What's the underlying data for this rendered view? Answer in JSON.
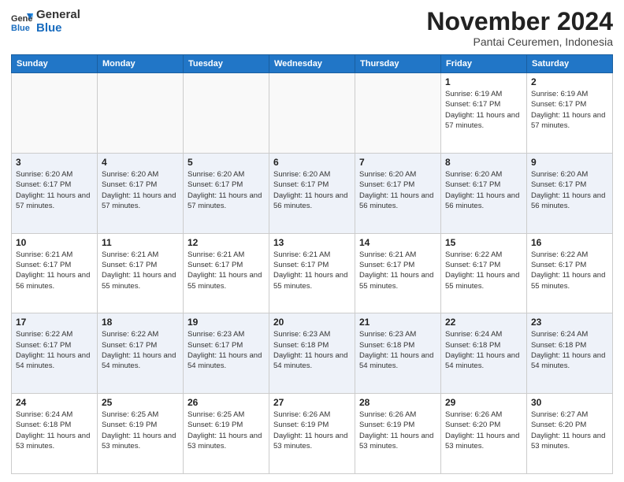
{
  "logo": {
    "general": "General",
    "blue": "Blue"
  },
  "title": "November 2024",
  "location": "Pantai Ceuremen, Indonesia",
  "days_header": [
    "Sunday",
    "Monday",
    "Tuesday",
    "Wednesday",
    "Thursday",
    "Friday",
    "Saturday"
  ],
  "weeks": [
    [
      {
        "day": "",
        "sunrise": "",
        "sunset": "",
        "daylight": ""
      },
      {
        "day": "",
        "sunrise": "",
        "sunset": "",
        "daylight": ""
      },
      {
        "day": "",
        "sunrise": "",
        "sunset": "",
        "daylight": ""
      },
      {
        "day": "",
        "sunrise": "",
        "sunset": "",
        "daylight": ""
      },
      {
        "day": "",
        "sunrise": "",
        "sunset": "",
        "daylight": ""
      },
      {
        "day": "1",
        "sunrise": "Sunrise: 6:19 AM",
        "sunset": "Sunset: 6:17 PM",
        "daylight": "Daylight: 11 hours and 57 minutes."
      },
      {
        "day": "2",
        "sunrise": "Sunrise: 6:19 AM",
        "sunset": "Sunset: 6:17 PM",
        "daylight": "Daylight: 11 hours and 57 minutes."
      }
    ],
    [
      {
        "day": "3",
        "sunrise": "Sunrise: 6:20 AM",
        "sunset": "Sunset: 6:17 PM",
        "daylight": "Daylight: 11 hours and 57 minutes."
      },
      {
        "day": "4",
        "sunrise": "Sunrise: 6:20 AM",
        "sunset": "Sunset: 6:17 PM",
        "daylight": "Daylight: 11 hours and 57 minutes."
      },
      {
        "day": "5",
        "sunrise": "Sunrise: 6:20 AM",
        "sunset": "Sunset: 6:17 PM",
        "daylight": "Daylight: 11 hours and 57 minutes."
      },
      {
        "day": "6",
        "sunrise": "Sunrise: 6:20 AM",
        "sunset": "Sunset: 6:17 PM",
        "daylight": "Daylight: 11 hours and 56 minutes."
      },
      {
        "day": "7",
        "sunrise": "Sunrise: 6:20 AM",
        "sunset": "Sunset: 6:17 PM",
        "daylight": "Daylight: 11 hours and 56 minutes."
      },
      {
        "day": "8",
        "sunrise": "Sunrise: 6:20 AM",
        "sunset": "Sunset: 6:17 PM",
        "daylight": "Daylight: 11 hours and 56 minutes."
      },
      {
        "day": "9",
        "sunrise": "Sunrise: 6:20 AM",
        "sunset": "Sunset: 6:17 PM",
        "daylight": "Daylight: 11 hours and 56 minutes."
      }
    ],
    [
      {
        "day": "10",
        "sunrise": "Sunrise: 6:21 AM",
        "sunset": "Sunset: 6:17 PM",
        "daylight": "Daylight: 11 hours and 56 minutes."
      },
      {
        "day": "11",
        "sunrise": "Sunrise: 6:21 AM",
        "sunset": "Sunset: 6:17 PM",
        "daylight": "Daylight: 11 hours and 55 minutes."
      },
      {
        "day": "12",
        "sunrise": "Sunrise: 6:21 AM",
        "sunset": "Sunset: 6:17 PM",
        "daylight": "Daylight: 11 hours and 55 minutes."
      },
      {
        "day": "13",
        "sunrise": "Sunrise: 6:21 AM",
        "sunset": "Sunset: 6:17 PM",
        "daylight": "Daylight: 11 hours and 55 minutes."
      },
      {
        "day": "14",
        "sunrise": "Sunrise: 6:21 AM",
        "sunset": "Sunset: 6:17 PM",
        "daylight": "Daylight: 11 hours and 55 minutes."
      },
      {
        "day": "15",
        "sunrise": "Sunrise: 6:22 AM",
        "sunset": "Sunset: 6:17 PM",
        "daylight": "Daylight: 11 hours and 55 minutes."
      },
      {
        "day": "16",
        "sunrise": "Sunrise: 6:22 AM",
        "sunset": "Sunset: 6:17 PM",
        "daylight": "Daylight: 11 hours and 55 minutes."
      }
    ],
    [
      {
        "day": "17",
        "sunrise": "Sunrise: 6:22 AM",
        "sunset": "Sunset: 6:17 PM",
        "daylight": "Daylight: 11 hours and 54 minutes."
      },
      {
        "day": "18",
        "sunrise": "Sunrise: 6:22 AM",
        "sunset": "Sunset: 6:17 PM",
        "daylight": "Daylight: 11 hours and 54 minutes."
      },
      {
        "day": "19",
        "sunrise": "Sunrise: 6:23 AM",
        "sunset": "Sunset: 6:17 PM",
        "daylight": "Daylight: 11 hours and 54 minutes."
      },
      {
        "day": "20",
        "sunrise": "Sunrise: 6:23 AM",
        "sunset": "Sunset: 6:18 PM",
        "daylight": "Daylight: 11 hours and 54 minutes."
      },
      {
        "day": "21",
        "sunrise": "Sunrise: 6:23 AM",
        "sunset": "Sunset: 6:18 PM",
        "daylight": "Daylight: 11 hours and 54 minutes."
      },
      {
        "day": "22",
        "sunrise": "Sunrise: 6:24 AM",
        "sunset": "Sunset: 6:18 PM",
        "daylight": "Daylight: 11 hours and 54 minutes."
      },
      {
        "day": "23",
        "sunrise": "Sunrise: 6:24 AM",
        "sunset": "Sunset: 6:18 PM",
        "daylight": "Daylight: 11 hours and 54 minutes."
      }
    ],
    [
      {
        "day": "24",
        "sunrise": "Sunrise: 6:24 AM",
        "sunset": "Sunset: 6:18 PM",
        "daylight": "Daylight: 11 hours and 53 minutes."
      },
      {
        "day": "25",
        "sunrise": "Sunrise: 6:25 AM",
        "sunset": "Sunset: 6:19 PM",
        "daylight": "Daylight: 11 hours and 53 minutes."
      },
      {
        "day": "26",
        "sunrise": "Sunrise: 6:25 AM",
        "sunset": "Sunset: 6:19 PM",
        "daylight": "Daylight: 11 hours and 53 minutes."
      },
      {
        "day": "27",
        "sunrise": "Sunrise: 6:26 AM",
        "sunset": "Sunset: 6:19 PM",
        "daylight": "Daylight: 11 hours and 53 minutes."
      },
      {
        "day": "28",
        "sunrise": "Sunrise: 6:26 AM",
        "sunset": "Sunset: 6:19 PM",
        "daylight": "Daylight: 11 hours and 53 minutes."
      },
      {
        "day": "29",
        "sunrise": "Sunrise: 6:26 AM",
        "sunset": "Sunset: 6:20 PM",
        "daylight": "Daylight: 11 hours and 53 minutes."
      },
      {
        "day": "30",
        "sunrise": "Sunrise: 6:27 AM",
        "sunset": "Sunset: 6:20 PM",
        "daylight": "Daylight: 11 hours and 53 minutes."
      }
    ]
  ]
}
